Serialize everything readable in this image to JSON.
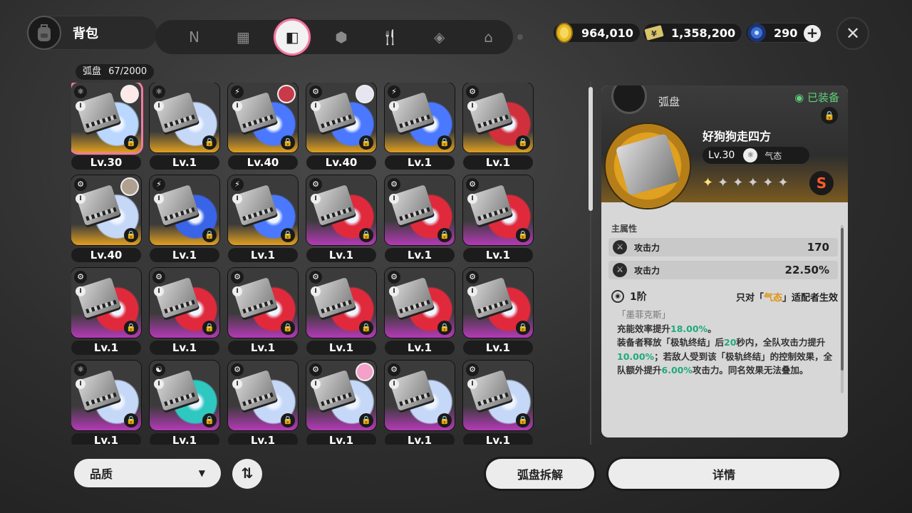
{
  "header": {
    "title": "背包",
    "tabs": [
      {
        "icon": "disc-n-icon",
        "glyph": "N",
        "active": false
      },
      {
        "icon": "console-icon",
        "glyph": "▦",
        "active": false
      },
      {
        "icon": "drive-disc-icon",
        "glyph": "◧",
        "active": true
      },
      {
        "icon": "cube-icon",
        "glyph": "⬢",
        "active": false
      },
      {
        "icon": "food-icon",
        "glyph": "🍴",
        "active": false
      },
      {
        "icon": "material-icon",
        "glyph": "◈",
        "active": false
      },
      {
        "icon": "home-icon",
        "glyph": "⌂",
        "active": false
      }
    ],
    "currencies": [
      {
        "name": "coin",
        "value": "964,010",
        "color": "#e8b820"
      },
      {
        "name": "credit",
        "value": "1,358,200",
        "color": "#d9c46a"
      },
      {
        "name": "energy",
        "value": "290",
        "color": "#3a6fd8"
      }
    ]
  },
  "inventory": {
    "label": "弧盘",
    "count": "67/2000",
    "cards": [
      {
        "level": "Lv.30",
        "tier": "gold",
        "attr": "⚛",
        "disc": "#b9d7ff",
        "avatar": "#ffe8e8",
        "selected": true
      },
      {
        "level": "Lv.1",
        "tier": "gold",
        "attr": "⚛",
        "disc": "#c5d8f8",
        "avatar": null,
        "selected": false
      },
      {
        "level": "Lv.40",
        "tier": "gold",
        "attr": "⚡",
        "disc": "#4a78ff",
        "avatar": "#c83a4a",
        "selected": false
      },
      {
        "level": "Lv.40",
        "tier": "gold",
        "attr": "⚙",
        "disc": "#4a78ff",
        "avatar": "#e6e6f0",
        "selected": false
      },
      {
        "level": "Lv.1",
        "tier": "gold",
        "attr": "⚡",
        "disc": "#4a78ff",
        "avatar": null,
        "selected": false
      },
      {
        "level": "Lv.1",
        "tier": "gold",
        "attr": "⚙",
        "disc": "#d0303c",
        "avatar": null,
        "selected": false
      },
      {
        "level": "Lv.40",
        "tier": "gold",
        "attr": "⚙",
        "disc": "#c5d8f8",
        "avatar": "#b0a090",
        "selected": false
      },
      {
        "level": "Lv.1",
        "tier": "gold",
        "attr": "⚡",
        "disc": "#3a64e8",
        "avatar": null,
        "selected": false
      },
      {
        "level": "Lv.1",
        "tier": "gold",
        "attr": "⚡",
        "disc": "#4a78ff",
        "avatar": null,
        "selected": false
      },
      {
        "level": "Lv.1",
        "tier": "purple",
        "attr": "⚙",
        "disc": "#e02a3c",
        "avatar": null,
        "selected": false
      },
      {
        "level": "Lv.1",
        "tier": "purple",
        "attr": "⚙",
        "disc": "#e02a3c",
        "avatar": null,
        "selected": false
      },
      {
        "level": "Lv.1",
        "tier": "purple",
        "attr": "⚙",
        "disc": "#e02a3c",
        "avatar": null,
        "selected": false
      },
      {
        "level": "Lv.1",
        "tier": "purple",
        "attr": "⚙",
        "disc": "#e02a3c",
        "avatar": null,
        "selected": false
      },
      {
        "level": "Lv.1",
        "tier": "purple",
        "attr": "⚙",
        "disc": "#e02a3c",
        "avatar": null,
        "selected": false
      },
      {
        "level": "Lv.1",
        "tier": "purple",
        "attr": "⚙",
        "disc": "#e02a3c",
        "avatar": null,
        "selected": false
      },
      {
        "level": "Lv.1",
        "tier": "purple",
        "attr": "⚙",
        "disc": "#e02a3c",
        "avatar": null,
        "selected": false
      },
      {
        "level": "Lv.1",
        "tier": "purple",
        "attr": "⚙",
        "disc": "#e02a3c",
        "avatar": null,
        "selected": false
      },
      {
        "level": "Lv.1",
        "tier": "purple",
        "attr": "⚙",
        "disc": "#e02a3c",
        "avatar": null,
        "selected": false
      },
      {
        "level": "Lv.1",
        "tier": "purple",
        "attr": "⚛",
        "disc": "#c5d8f8",
        "avatar": null,
        "selected": false
      },
      {
        "level": "Lv.1",
        "tier": "purple",
        "attr": "☯",
        "disc": "#2fc8c0",
        "avatar": null,
        "selected": false
      },
      {
        "level": "Lv.1",
        "tier": "purple",
        "attr": "⚙",
        "disc": "#c5d8f8",
        "avatar": null,
        "selected": false
      },
      {
        "level": "Lv.1",
        "tier": "purple",
        "attr": "⚙",
        "disc": "#c5d8f8",
        "avatar": "#f4a0c8",
        "selected": false
      },
      {
        "level": "Lv.1",
        "tier": "purple",
        "attr": "⚙",
        "disc": "#c5d8f8",
        "avatar": null,
        "selected": false
      },
      {
        "level": "Lv.1",
        "tier": "purple",
        "attr": "⚙",
        "disc": "#c5d8f8",
        "avatar": null,
        "selected": false
      }
    ]
  },
  "bottom": {
    "quality_label": "品质",
    "quality_arrow": "▼",
    "sort_glyph": "⇅",
    "dismantle_label": "弧盘拆解",
    "details_label": "详情"
  },
  "detail": {
    "category": "弧盘",
    "equipped": "◉ 已装备",
    "name": "好狗狗走四方",
    "level": "Lv.30",
    "attr_type": "气态",
    "stars": [
      "✦",
      "✦",
      "✦",
      "✦",
      "✦",
      "✦"
    ],
    "rank": "S",
    "main_attr_label": "主属性",
    "stats": [
      {
        "name": "攻击力",
        "value": "170"
      },
      {
        "name": "攻击力",
        "value": "22.50%"
      }
    ],
    "tier": "1阶",
    "condition_pre": "只对「",
    "condition_hl": "气态",
    "condition_post": "」适配者生效",
    "effect_title": "「墨菲克斯」",
    "effect_1a": "充能效率提升",
    "effect_1b": "18.00%",
    "effect_1c": "。",
    "effect_2a": "装备者释放「极轨终结」后",
    "effect_2b": "20",
    "effect_2c": "秒内，全队攻击力提升",
    "effect_2d": "10.00%",
    "effect_2e": "；若敌人受到该「极轨终结」的控制效果，全队额外提升",
    "effect_2f": "6.00%",
    "effect_2g": "攻击力。同名效果无法叠加。"
  }
}
